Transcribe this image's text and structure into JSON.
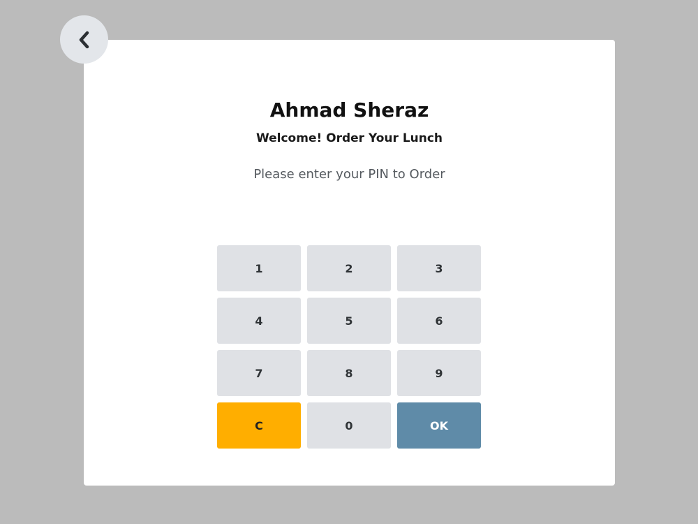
{
  "header": {
    "back_icon": "chevron-left-icon"
  },
  "card": {
    "user_name": "Ahmad Sheraz",
    "welcome": "Welcome! Order Your Lunch",
    "prompt": "Please enter your PIN to Order"
  },
  "keypad": {
    "keys": [
      "1",
      "2",
      "3",
      "4",
      "5",
      "6",
      "7",
      "8",
      "9"
    ],
    "clear_label": "C",
    "zero_label": "0",
    "ok_label": "OK"
  },
  "colors": {
    "background": "#bbbbbb",
    "card": "#ffffff",
    "key": "#dfe1e5",
    "clear_key": "#ffae00",
    "ok_key": "#5f8ba8"
  }
}
